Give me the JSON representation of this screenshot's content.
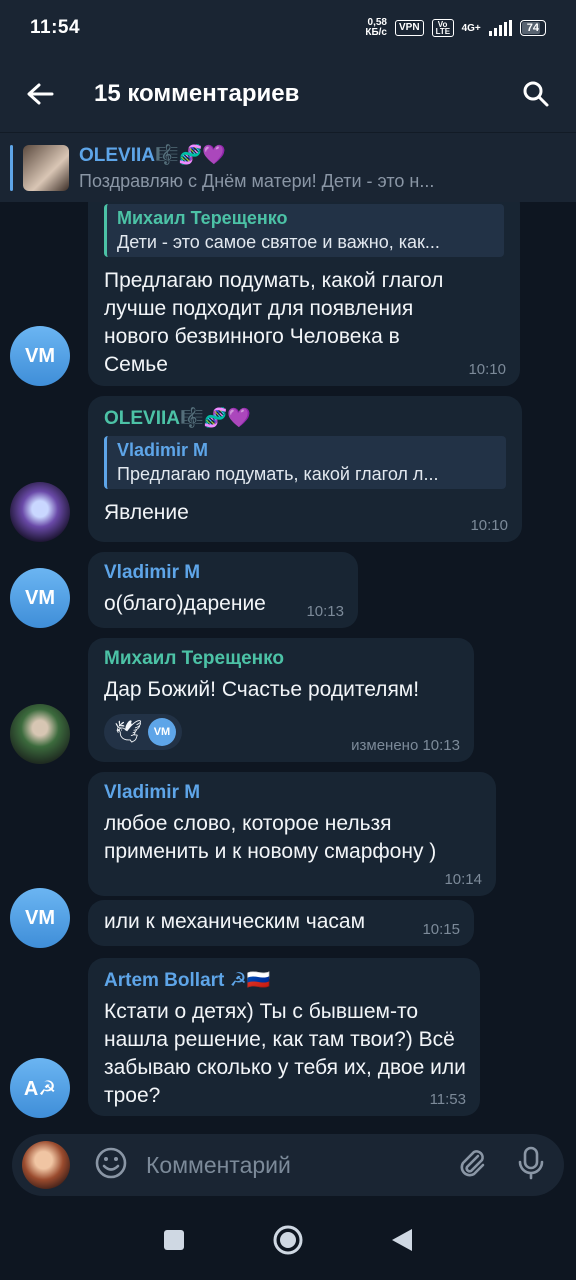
{
  "status": {
    "time": "11:54",
    "netspeed_value": "0,58",
    "netspeed_unit": "КБ/с",
    "vpn": "VPN",
    "volte": "Vo LTE",
    "network": "4G+",
    "battery": "74"
  },
  "header": {
    "title": "15 комментариев"
  },
  "pinned": {
    "author": "OLEVIIA🎼🧬💜",
    "text": "Поздравляю с Днём матери!   Дети - это н..."
  },
  "messages": [
    {
      "reply_name": "Михаил Терещенко",
      "reply_text": "Дети - это самое святое и важно, как...",
      "text": "Предлагаю подумать, какой глагол лучше подходит для появления нового безвинного Человека в Семье",
      "time": "10:10",
      "avatar": "VM"
    },
    {
      "name": "OLEVIIA🎼🧬💜",
      "reply_name": "Vladimir M",
      "reply_text": "Предлагаю подумать, какой глагол л...",
      "text": "Явление",
      "time": "10:10"
    },
    {
      "name": "Vladimir M",
      "text": "о(благо)дарение",
      "time": "10:13",
      "avatar": "VM"
    },
    {
      "name": "Михаил Терещенко",
      "text": "Дар Божий! Счастье родителям!",
      "reaction_emoji": "🕊",
      "reaction_user": "VM",
      "time": "изменено 10:13"
    },
    {
      "name": "Vladimir M",
      "text": "любое слово, которое нельзя применить и к новому смарфону )",
      "time": "10:14"
    },
    {
      "text": "или к механическим часам",
      "time": "10:15",
      "avatar": "VM"
    },
    {
      "name": "Artem Bollart ☭🇷🇺",
      "text": "Кстати о детях) Ты с бывшем-то нашла решение, как там твои?) Всё забываю сколько у тебя их, двое или трое?",
      "time": "11:53",
      "avatar": "А☭"
    }
  ],
  "input": {
    "placeholder": "Комментарий"
  },
  "colors": {
    "background": "#0e1621",
    "bubble": "#182533",
    "accent_blue": "#5ea5e8",
    "name_teal": "#4cc2a6"
  }
}
